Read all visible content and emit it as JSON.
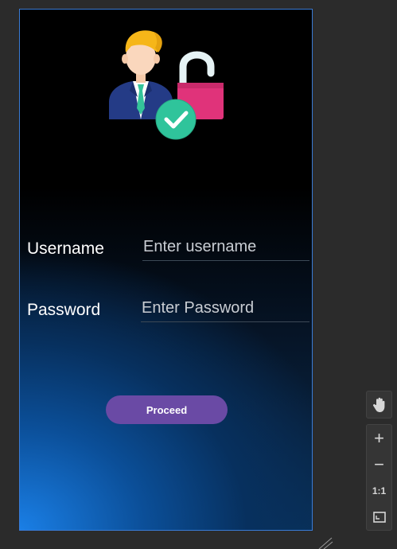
{
  "form": {
    "username_label": "Username",
    "username_placeholder": "Enter username",
    "password_label": "Password",
    "password_placeholder": "Enter Password",
    "proceed_label": "Proceed"
  },
  "hero": {
    "icon": "user-unlocked-verified-icon"
  },
  "toolbar": {
    "pan_icon": "hand-icon",
    "zoom_in_label": "+",
    "zoom_out_label": "−",
    "actual_size_label": "1:1",
    "fit_icon": "fit-screen-icon"
  },
  "colors": {
    "accent": "#6a4aa5",
    "frame_border": "#3a7bd5",
    "editor_bg": "#2b2b2b"
  }
}
